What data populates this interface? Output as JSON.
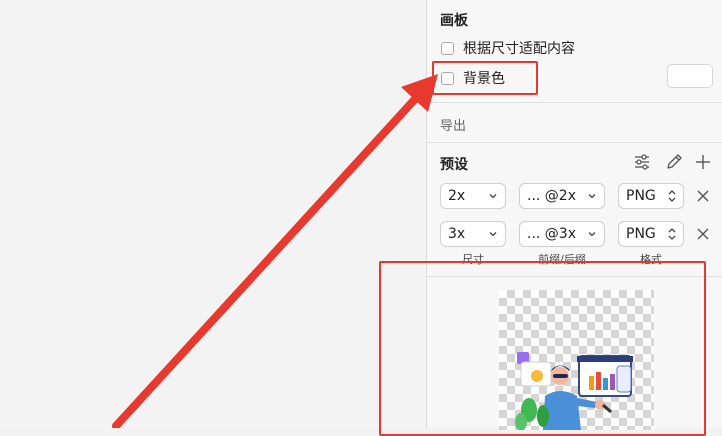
{
  "panel": {
    "artboard_title": "画板",
    "fit_content_label": "根据尺寸适配内容",
    "background_color_label": "背景色",
    "export_title": "导出",
    "presets_title": "预设",
    "rows": [
      {
        "size": "2x",
        "suffix": "... @2x",
        "format": "PNG"
      },
      {
        "size": "3x",
        "suffix": "... @3x",
        "format": "PNG"
      }
    ],
    "column_labels": {
      "size": "尺寸",
      "suffix": "前缀/后缀",
      "format": "格式"
    }
  },
  "icons": {
    "settings": "sliders-icon",
    "edit": "pen-icon",
    "add": "plus-icon",
    "remove": "close-icon"
  },
  "annotation_color": "#e03b32"
}
